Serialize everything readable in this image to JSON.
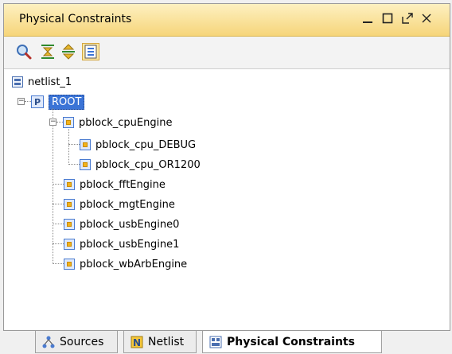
{
  "panel": {
    "title": "Physical Constraints",
    "window_buttons": [
      "minimize-icon",
      "restore-icon",
      "float-icon",
      "close-icon"
    ]
  },
  "toolbar": {
    "buttons": [
      {
        "icon": "search-icon"
      },
      {
        "icon": "collapse-all-icon"
      },
      {
        "icon": "expand-all-icon"
      },
      {
        "icon": "show-pblocks-icon",
        "active": true
      }
    ]
  },
  "tree": {
    "root_label": "netlist_1",
    "root_pblock": "ROOT",
    "cpu_engine": "pblock_cpuEngine",
    "cpu_children": [
      "pblock_cpu_DEBUG",
      "pblock_cpu_OR1200"
    ],
    "others": [
      "pblock_fftEngine",
      "pblock_mgtEngine",
      "pblock_usbEngine0",
      "pblock_usbEngine1",
      "pblock_wbArbEngine"
    ]
  },
  "tabs": [
    {
      "label": "Sources",
      "icon": "sources-icon"
    },
    {
      "label": "Netlist",
      "icon": "netlist-icon"
    },
    {
      "label": "Physical Constraints",
      "icon": "physical-constraints-icon",
      "active": true
    }
  ],
  "colors": {
    "title_bar": "#f6d57a",
    "selection": "#3b74d6"
  }
}
